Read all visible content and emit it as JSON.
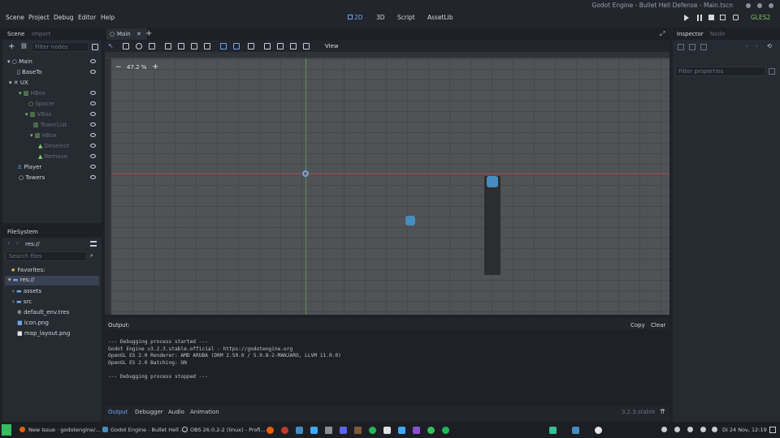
{
  "window": {
    "title": "Godot Engine - Bullet Hell Defense - Main.tscn"
  },
  "menubar": {
    "items": [
      "Scene",
      "Project",
      "Debug",
      "Editor",
      "Help"
    ],
    "workspaces": [
      "2D",
      "3D",
      "Script",
      "AssetLib"
    ],
    "renderer": "GLES2"
  },
  "scene_panel": {
    "tabs": [
      "Scene",
      "Import"
    ],
    "filter_placeholder": "Filter nodes",
    "nodes": [
      {
        "label": "Main",
        "dim": false
      },
      {
        "label": "BaseTo",
        "dim": false
      },
      {
        "label": "UX",
        "dim": false
      },
      {
        "label": "HBox",
        "dim": true
      },
      {
        "label": "Spacer",
        "dim": true
      },
      {
        "label": "VBox",
        "dim": true
      },
      {
        "label": "TowerList",
        "dim": true
      },
      {
        "label": "HBox",
        "dim": true
      },
      {
        "label": "Deselect",
        "dim": true
      },
      {
        "label": "Remove",
        "dim": true
      },
      {
        "label": "Player",
        "dim": false
      },
      {
        "label": "Towers",
        "dim": false
      }
    ]
  },
  "filesystem": {
    "title": "FileSystem",
    "path": "res://",
    "search_placeholder": "Search files",
    "items": [
      {
        "label": "Favorites:"
      },
      {
        "label": "res://"
      },
      {
        "label": "assets"
      },
      {
        "label": "src"
      },
      {
        "label": "default_env.tres"
      },
      {
        "label": "icon.png"
      },
      {
        "label": "map_layout.png"
      }
    ]
  },
  "editor": {
    "scene_tab": "Main",
    "view_menu": "View",
    "zoom": "47.2 %"
  },
  "inspector": {
    "tabs": [
      "Inspector",
      "Node"
    ],
    "filter_placeholder": "Filter properties"
  },
  "output": {
    "label": "Output:",
    "copy_label": "Copy",
    "clear_label": "Clear",
    "lines": [
      "--- Debugging process started ---",
      "Godot Engine v3.2.3.stable.official - https://godotengine.org",
      "OpenGL ES 2.0 Renderer: AMD ARUBA (DRM 2.50.0 / 5.9.8-2-MANJARO, LLVM 11.0.0)",
      "OpenGL ES 2.0 Batching: ON",
      "",
      "--- Debugging process stopped ---"
    ],
    "bottom_tabs": [
      "Output",
      "Debugger",
      "Audio",
      "Animation"
    ],
    "version": "3.2.3.stable"
  },
  "taskbar": {
    "tasks": [
      "New Issue · godotengine/...",
      "Godot Engine - Bullet Hell ...",
      "OBS 26.0.2-2 (linux) - Profi..."
    ],
    "clock": "Di 24 Nov, 12:19"
  },
  "colors": {
    "accent": "#6ba6f0",
    "viewport_bg": "#505256",
    "tower": "#2b2d31"
  }
}
